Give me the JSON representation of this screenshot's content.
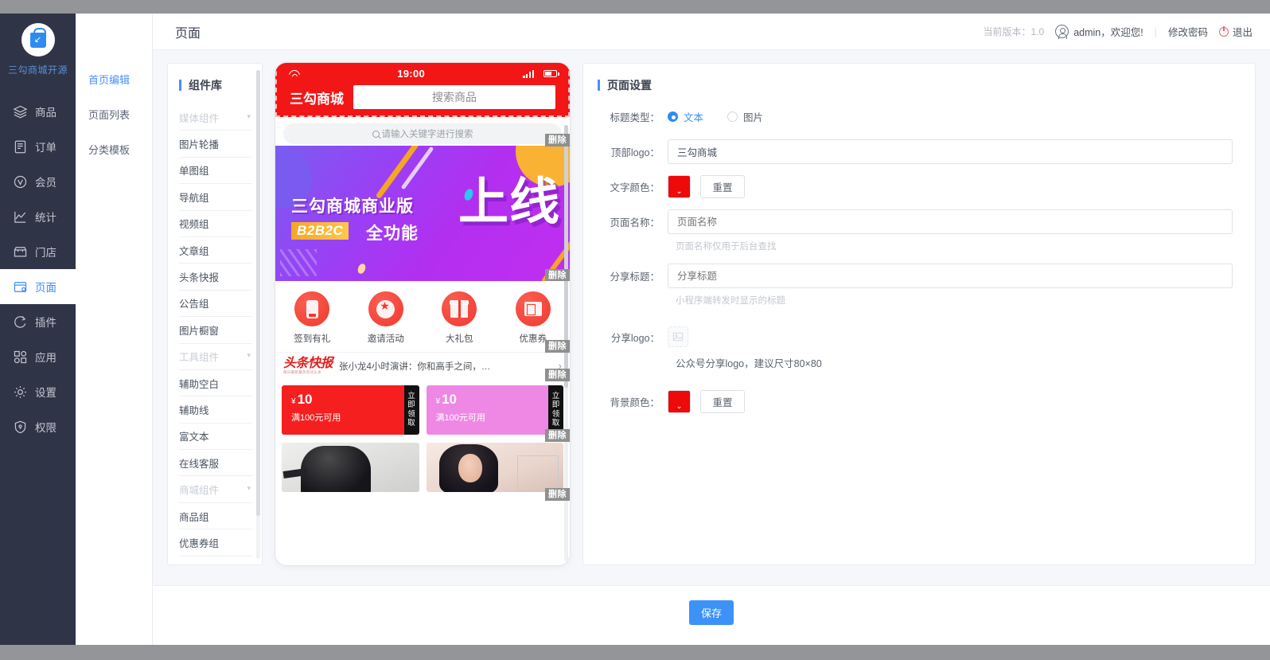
{
  "sidebar": {
    "brand_name": "三勾商城开源",
    "items": [
      {
        "label": "商品",
        "icon": "layers-icon"
      },
      {
        "label": "订单",
        "icon": "document-icon"
      },
      {
        "label": "会员",
        "icon": "vip-circle-icon"
      },
      {
        "label": "统计",
        "icon": "chart-line-icon"
      },
      {
        "label": "门店",
        "icon": "store-icon"
      },
      {
        "label": "页面",
        "icon": "page-window-icon"
      },
      {
        "label": "插件",
        "icon": "plugin-circle-icon"
      },
      {
        "label": "应用",
        "icon": "apps-grid-icon"
      },
      {
        "label": "设置",
        "icon": "gear-icon"
      },
      {
        "label": "权限",
        "icon": "shield-lock-icon"
      }
    ],
    "active": "页面"
  },
  "subnav": {
    "items": [
      "首页编辑",
      "页面列表",
      "分类模板"
    ],
    "active": "首页编辑"
  },
  "header": {
    "title": "页面",
    "version_label": "当前版本：1.0",
    "user_greeting": "admin，欢迎您!",
    "separator": "|",
    "change_password": "修改密码",
    "logout": "退出"
  },
  "library": {
    "title": "组件库",
    "rows": [
      {
        "label": "媒体组件",
        "group": true
      },
      {
        "label": "图片轮播",
        "group": false
      },
      {
        "label": "单图组",
        "group": false
      },
      {
        "label": "导航组",
        "group": false
      },
      {
        "label": "视频组",
        "group": false
      },
      {
        "label": "文章组",
        "group": false
      },
      {
        "label": "头条快报",
        "group": false
      },
      {
        "label": "公告组",
        "group": false
      },
      {
        "label": "图片橱窗",
        "group": false
      },
      {
        "label": "工具组件",
        "group": true
      },
      {
        "label": "辅助空白",
        "group": false
      },
      {
        "label": "辅助线",
        "group": false
      },
      {
        "label": "富文本",
        "group": false
      },
      {
        "label": "在线客服",
        "group": false
      },
      {
        "label": "商城组件",
        "group": true
      },
      {
        "label": "商品组",
        "group": false
      },
      {
        "label": "优惠券组",
        "group": false
      }
    ],
    "caret": "▾"
  },
  "preview": {
    "status_time": "19:00",
    "top_logo": "三勾商城",
    "search_button": "搜索商品",
    "search_placeholder": "请输入关键字进行搜索",
    "delete_label": "删除",
    "banner": {
      "line1": "三勾商城商业版",
      "tag": "B2B2C",
      "line2": "全功能",
      "big": "上线"
    },
    "nav_icons": [
      {
        "label": "签到有礼",
        "icon": "signin-phone-icon"
      },
      {
        "label": "邀请活动",
        "icon": "star-badge-icon"
      },
      {
        "label": "大礼包",
        "icon": "gift-box-icon"
      },
      {
        "label": "优惠券",
        "icon": "coupon-ticket-icon"
      }
    ],
    "news": {
      "logo": "头条快报",
      "logo_sub": "每日最新最热资讯头条",
      "text": "张小龙4小时演讲：你和高手之间，…",
      "arrow": "›"
    },
    "coupons": [
      {
        "amount": "10",
        "currency": "¥",
        "condition": "满100元可用",
        "action": "立即领取",
        "color": "red"
      },
      {
        "amount": "10",
        "currency": "¥",
        "condition": "满100元可用",
        "action": "立即领取",
        "color": "pink"
      }
    ]
  },
  "settings": {
    "title": "页面设置",
    "title_type": {
      "label": "标题类型：",
      "options": [
        "文本",
        "图片"
      ],
      "selected": "文本"
    },
    "top_logo": {
      "label": "顶部logo：",
      "value": "三勾商城",
      "placeholder": "顶部logo"
    },
    "text_color": {
      "label": "文字颜色：",
      "color": "#ee0a0a",
      "reset": "重置",
      "caret": "⌄"
    },
    "page_name": {
      "label": "页面名称：",
      "value": "",
      "placeholder": "页面名称",
      "hint": "页面名称仅用于后台查找"
    },
    "share_title": {
      "label": "分享标题：",
      "value": "",
      "placeholder": "分享标题",
      "hint": "小程序端转发时显示的标题"
    },
    "share_logo": {
      "label": "分享logo：",
      "hint": "公众号分享logo，建议尺寸80×80",
      "icon": "image-placeholder-icon"
    },
    "bg_color": {
      "label": "背景颜色：",
      "color": "#ee0a0a",
      "reset": "重置",
      "caret": "⌄"
    }
  },
  "footer": {
    "save_label": "保存"
  },
  "colors": {
    "accent": "#3d92f7",
    "sidebar_bg": "#2f3446",
    "brand_text": "#5b8fd6",
    "phone_red": "#f21616",
    "coupon_red": "#f61f1f",
    "coupon_pink": "#ee88e4"
  }
}
